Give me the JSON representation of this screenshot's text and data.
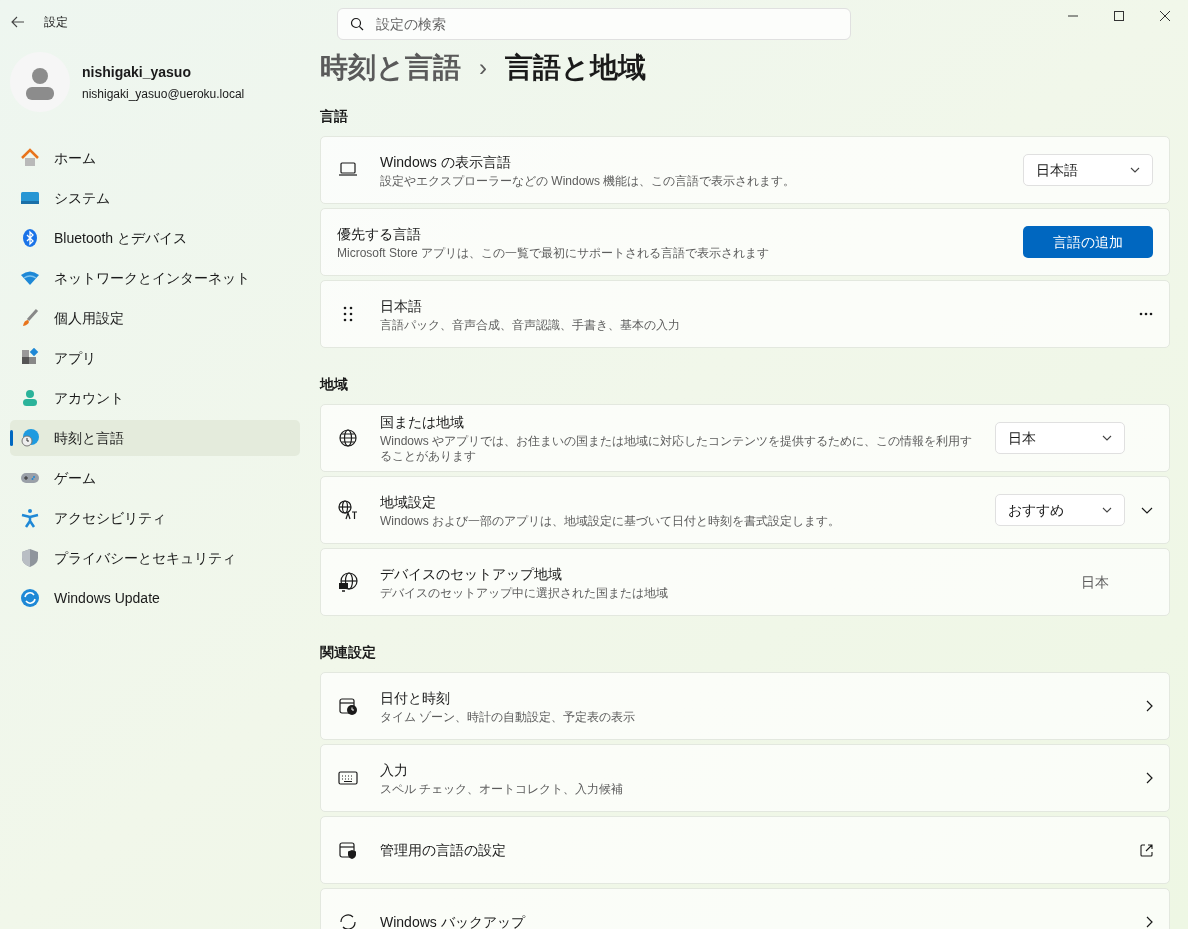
{
  "window": {
    "title": "設定",
    "search": {
      "placeholder": "設定の検索"
    }
  },
  "user": {
    "name": "nishigaki_yasuo",
    "email": "nishigaki_yasuo@ueroku.local"
  },
  "sidebar": {
    "items": [
      {
        "label": "ホーム",
        "selected": false
      },
      {
        "label": "システム",
        "selected": false
      },
      {
        "label": "Bluetooth とデバイス",
        "selected": false
      },
      {
        "label": "ネットワークとインターネット",
        "selected": false
      },
      {
        "label": "個人用設定",
        "selected": false
      },
      {
        "label": "アプリ",
        "selected": false
      },
      {
        "label": "アカウント",
        "selected": false
      },
      {
        "label": "時刻と言語",
        "selected": true
      },
      {
        "label": "ゲーム",
        "selected": false
      },
      {
        "label": "アクセシビリティ",
        "selected": false
      },
      {
        "label": "プライバシーとセキュリティ",
        "selected": false
      },
      {
        "label": "Windows Update",
        "selected": false
      }
    ]
  },
  "breadcrumb": {
    "parent": "時刻と言語",
    "separator": "›",
    "current": "言語と地域"
  },
  "sections": [
    {
      "heading": "言語",
      "cards": [
        {
          "kind": "dropdown",
          "title": "Windows の表示言語",
          "description": "設定やエクスプローラーなどの Windows 機能は、この言語で表示されます。",
          "value": "日本語"
        },
        {
          "kind": "button",
          "title": "優先する言語",
          "description": "Microsoft Store アプリは、この一覧で最初にサポートされる言語で表示されます",
          "value": "言語の追加"
        },
        {
          "kind": "more",
          "title": "日本語",
          "description": "言語パック、音声合成、音声認識、手書き、基本の入力"
        }
      ]
    },
    {
      "heading": "地域",
      "cards": [
        {
          "kind": "dropdown",
          "title": "国または地域",
          "description": "Windows やアプリでは、お住まいの国または地域に対応したコンテンツを提供するために、この情報を利用することがあります",
          "value": "日本"
        },
        {
          "kind": "dropdown-expand",
          "title": "地域設定",
          "description": "Windows および一部のアプリは、地域設定に基づいて日付と時刻を書式設定します。",
          "value": "おすすめ",
          "expanded": false
        },
        {
          "kind": "value",
          "title": "デバイスのセットアップ地域",
          "description": "デバイスのセットアップ中に選択された国または地域",
          "value": "日本"
        }
      ]
    },
    {
      "heading": "関連設定",
      "cards": [
        {
          "kind": "chevron",
          "title": "日付と時刻",
          "description": "タイム ゾーン、時計の自動設定、予定表の表示"
        },
        {
          "kind": "chevron",
          "title": "入力",
          "description": "スペル チェック、オートコレクト、入力候補"
        },
        {
          "kind": "external",
          "title": "管理用の言語の設定"
        },
        {
          "kind": "chevron",
          "title": "Windows バックアップ"
        }
      ]
    }
  ]
}
